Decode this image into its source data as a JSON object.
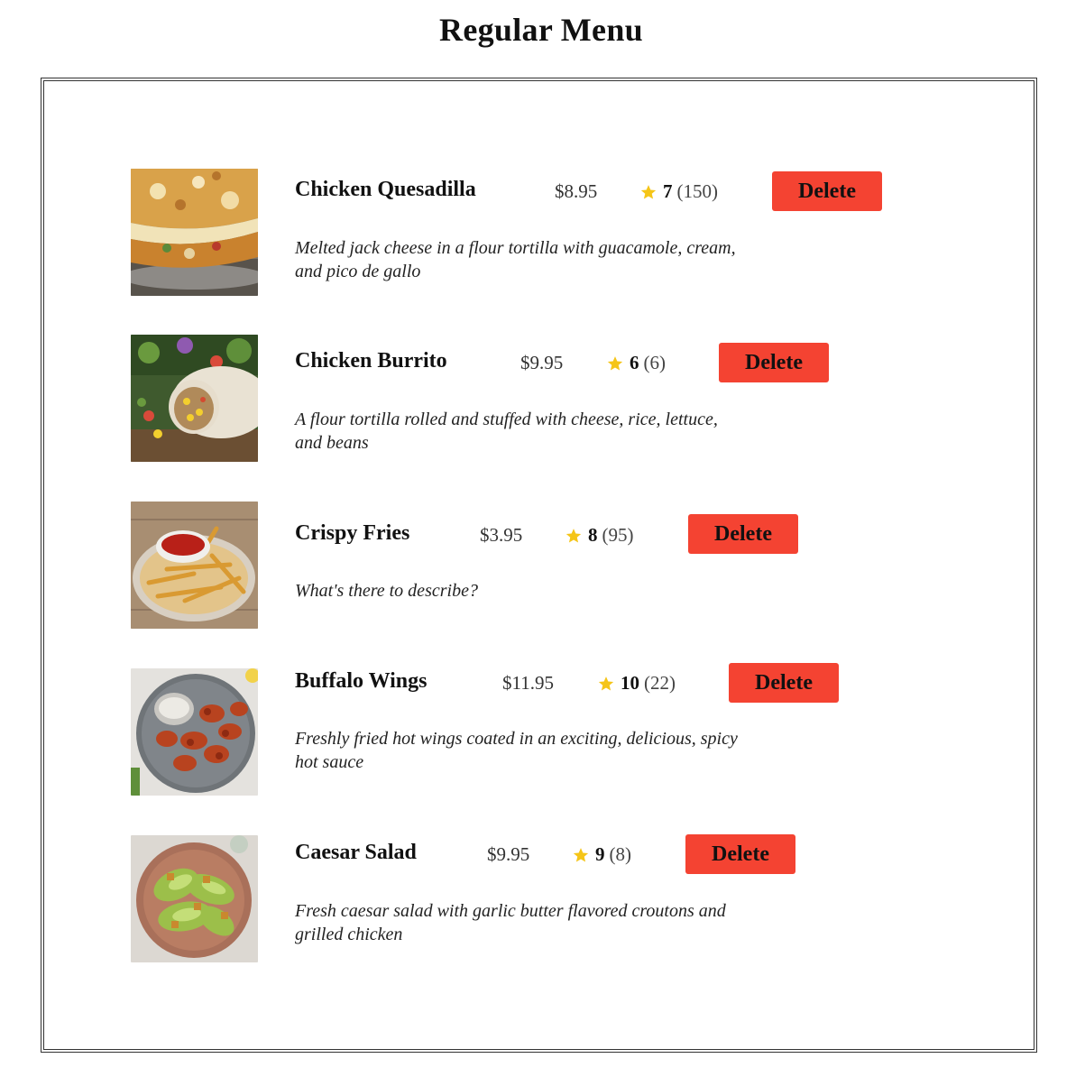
{
  "page": {
    "title": "Regular Menu"
  },
  "colors": {
    "delete_button": "#f44332",
    "star": "#f5c518",
    "border": "#333333"
  },
  "menu": {
    "items": [
      {
        "name": "Chicken Quesadilla",
        "price": "$8.95",
        "rating": "7",
        "review_count": "(150)",
        "description": "Melted jack cheese in a flour tortilla with guacamole, cream, and pico de gallo",
        "delete_label": "Delete",
        "image": "chicken-quesadilla-photo"
      },
      {
        "name": "Chicken Burrito",
        "price": "$9.95",
        "rating": "6",
        "review_count": "(6)",
        "description": "A flour tortilla rolled and stuffed with cheese, rice, lettuce, and beans",
        "delete_label": "Delete",
        "image": "chicken-burrito-photo"
      },
      {
        "name": "Crispy Fries",
        "price": "$3.95",
        "rating": "8",
        "review_count": "(95)",
        "description": "What's there to describe?",
        "delete_label": "Delete",
        "image": "crispy-fries-photo"
      },
      {
        "name": "Buffalo Wings",
        "price": "$11.95",
        "rating": "10",
        "review_count": "(22)",
        "description": "Freshly fried hot wings coated in an exciting, delicious, spicy hot sauce",
        "delete_label": "Delete",
        "image": "buffalo-wings-photo"
      },
      {
        "name": "Caesar Salad",
        "price": "$9.95",
        "rating": "9",
        "review_count": "(8)",
        "description": "Fresh caesar salad with garlic butter flavored croutons and grilled chicken",
        "delete_label": "Delete",
        "image": "caesar-salad-photo"
      }
    ]
  }
}
